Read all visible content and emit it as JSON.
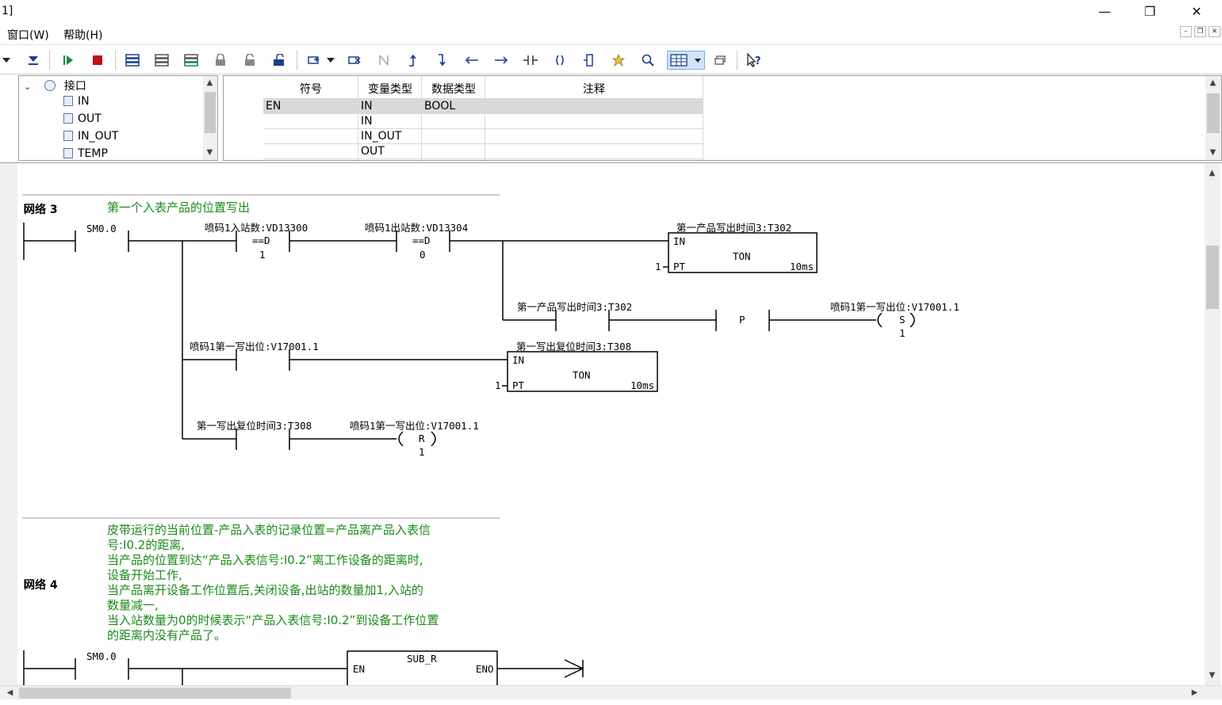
{
  "window": {
    "title": "1]",
    "minimize": "—",
    "restore": "❐",
    "close": "✕"
  },
  "menu": [
    {
      "label": "窗口(W)"
    },
    {
      "label": "帮助(H)"
    }
  ],
  "mdi_buttons": [
    "–",
    "❐",
    "✕"
  ],
  "toolbar_icons": [
    "dropdown-arrow-icon",
    "download-icon",
    "run-icon",
    "stop-icon",
    "program-block-icon",
    "program-block-2-icon",
    "program-block-3-icon",
    "lock-icon",
    "unlock-icon",
    "protect-icon",
    "insert-network-icon",
    "delete-network-icon",
    "n-contact-icon",
    "up-line-icon",
    "down-line-icon",
    "left-line-icon",
    "right-line-icon",
    "contact-icon",
    "coil-icon",
    "box-icon",
    "bookmark-icon",
    "zoom-icon",
    "grid-icon",
    "window-icon",
    "help-icon"
  ],
  "tree": {
    "root": "接口",
    "items": [
      "IN",
      "OUT",
      "IN_OUT",
      "TEMP"
    ]
  },
  "var_table": {
    "headers": [
      "符号",
      "变量类型",
      "数据类型",
      "注释"
    ],
    "rows": [
      {
        "symbol": "EN",
        "var_type": "IN",
        "data_type": "BOOL",
        "comment": ""
      },
      {
        "symbol": "",
        "var_type": "IN",
        "data_type": "",
        "comment": ""
      },
      {
        "symbol": "",
        "var_type": "IN_OUT",
        "data_type": "",
        "comment": ""
      },
      {
        "symbol": "",
        "var_type": "OUT",
        "data_type": "",
        "comment": ""
      }
    ]
  },
  "networks": [
    {
      "label": "网络 3",
      "comment": [
        "第一个入表产品的位置写出"
      ],
      "elements": {
        "c1": "SM0.0",
        "cmp1_label": "喷码1入站数:VD13300",
        "cmp1_op": "==D",
        "cmp1_val": "1",
        "cmp2_label": "喷码1出站数:VD13304",
        "cmp2_op": "==D",
        "cmp2_val": "0",
        "ton1_label": "第一产品写出时间3:T302",
        "ton_in": "IN",
        "ton_name": "TON",
        "ton_pt": "PT",
        "ton_base": "10ms",
        "ton1_pt_val": "1",
        "c_t302": "第一产品写出时间3:T302",
        "p": "P",
        "coil_s_label": "喷码1第一写出位:V17001.1",
        "coil_s": "S",
        "coil_s_n": "1",
        "c_v17001": "喷码1第一写出位:V17001.1",
        "ton2_label": "第一写出复位时间3:T308",
        "ton2_pt_val": "1",
        "c_t308": "第一写出复位时间3:T308",
        "coil_r_label": "喷码1第一写出位:V17001.1",
        "coil_r": "R",
        "coil_r_n": "1"
      }
    },
    {
      "label": "网络 4",
      "comment": [
        "皮带运行的当前位置-产品入表的记录位置=产品离产品入表信",
        "号:I0.2的距离,",
        "当产品的位置到达“产品入表信号:I0.2”离工作设备的距离时,",
        "设备开始工作,",
        "当产品离开设备工作位置后,关闭设备,出站的数量加1,入站的",
        "数量减一,",
        "当入站数量为0的时候表示“产品入表信号:I0.2”到设备工作位置",
        "的距离内没有产品了。"
      ],
      "elements": {
        "c1": "SM0.0",
        "box": "SUB_R",
        "en": "EN",
        "eno": "ENO"
      }
    }
  ]
}
